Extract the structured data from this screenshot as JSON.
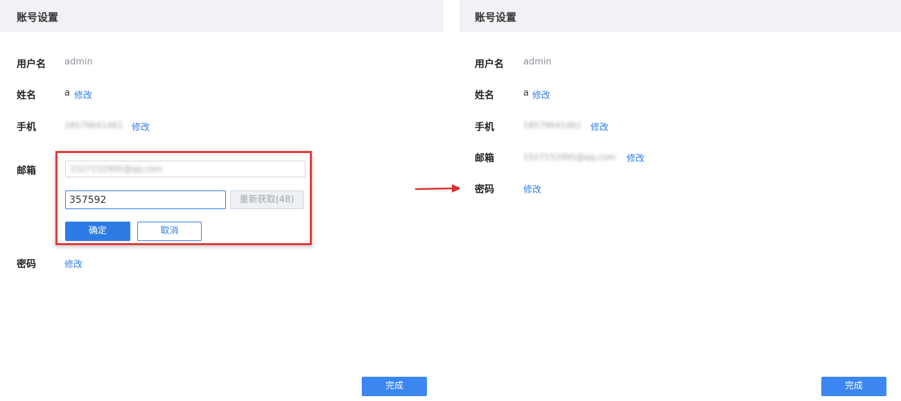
{
  "left_panel": {
    "title": "账号设置",
    "username_label": "用户名",
    "username_value": "admin",
    "name_label": "姓名",
    "name_value": "a",
    "name_edit": "修改",
    "phone_label": "手机",
    "phone_value": "18579641461",
    "phone_edit": "修改",
    "email_label": "邮箱",
    "email_value": "1527152995@qq.com",
    "code_value": "357592",
    "resend_label": "重新获取(48)",
    "confirm_label": "确定",
    "cancel_label": "取消",
    "password_label": "密码",
    "password_edit": "修改",
    "done_label": "完成"
  },
  "right_panel": {
    "title": "账号设置",
    "username_label": "用户名",
    "username_value": "admin",
    "name_label": "姓名",
    "name_value": "a",
    "name_edit": "修改",
    "phone_label": "手机",
    "phone_value": "18579641461",
    "phone_edit": "修改",
    "email_label": "邮箱",
    "email_value": "1527152995@qq.com",
    "email_edit": "修改",
    "password_label": "密码",
    "password_edit": "修改",
    "done_label": "完成"
  },
  "colors": {
    "accent": "#2d7ce6",
    "highlight_border": "#e23b3b",
    "header_bg": "#f0f2f5"
  },
  "icons": {
    "transition_arrow": "arrow-right-icon"
  }
}
